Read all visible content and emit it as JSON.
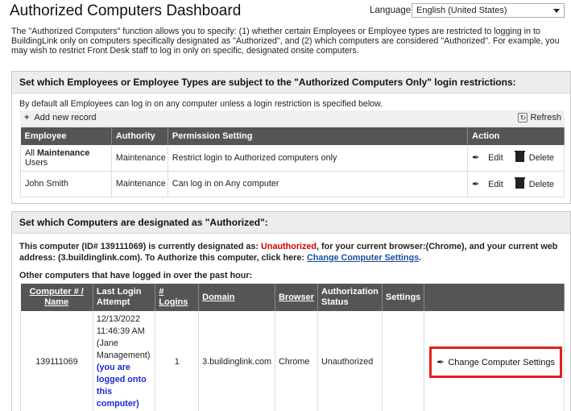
{
  "header": {
    "title": "Authorized Computers Dashboard",
    "language_label": "Language:",
    "language_value": "English (United States)"
  },
  "intro": "The \"Authorized Computers\" function allows you to specify: (1) whether certain Employees or Employee types are restricted to logging in to BuildingLink only on computers specifically designated as \"Authorized\", and (2) which computers are considered \"Authorized\". For example, you may wish to restrict Front Desk staff to log in only on specific, designated onsite computers.",
  "panel1": {
    "heading": "Set which Employees or Employee Types are subject to the \"Authorized Computers Only\" login restrictions:",
    "note": "By default all Employees can log in on any computer unless a login restriction is specified below.",
    "add_label": "Add new record",
    "refresh_label": "Refresh",
    "columns": [
      "Employee",
      "Authority",
      "Permission Setting",
      "Action"
    ],
    "rows": [
      {
        "employee_prefix": "All ",
        "employee_bold": "Maintenance",
        "employee_suffix": " Users",
        "authority": "Maintenance",
        "permission": "Restrict login to Authorized computers only",
        "edit": "Edit",
        "delete": "Delete"
      },
      {
        "employee_prefix": "John Smith",
        "employee_bold": "",
        "employee_suffix": "",
        "authority": "Maintenance",
        "permission": "Can log in on Any computer",
        "edit": "Edit",
        "delete": "Delete"
      }
    ]
  },
  "panel2": {
    "heading": "Set which Computers are designated as \"Authorized\":",
    "status_part1": "This computer (ID# 139111069) is currently designated as: ",
    "status_value": "Unauthorized",
    "status_part2": ", for your current browser:(Chrome), and your current web address: (3.buildinglink.com). To Authorize this computer, click here: ",
    "status_link": "Change Computer Settings",
    "status_end": ".",
    "other_label": "Other computers that have logged in over the past hour:",
    "columns": [
      "Computer # / Name",
      "Last Login Attempt",
      "# Logins",
      "Domain",
      "Browser",
      "Authorization Status",
      "Settings"
    ],
    "rows": [
      {
        "computer": "139111069",
        "last_login": "12/13/2022 11:46:39 AM (Jane Management)",
        "last_login_note": "(you are logged onto this computer)",
        "logins": "1",
        "domain": "3.buildinglink.com",
        "browser": "Chrome",
        "status": "Unauthorized",
        "settings_button": "Change Computer Settings"
      }
    ]
  },
  "colors": {
    "table_header": "#555555",
    "unauthorized": "#d10000",
    "link": "#1a4d9e",
    "highlight": "#e02020"
  }
}
